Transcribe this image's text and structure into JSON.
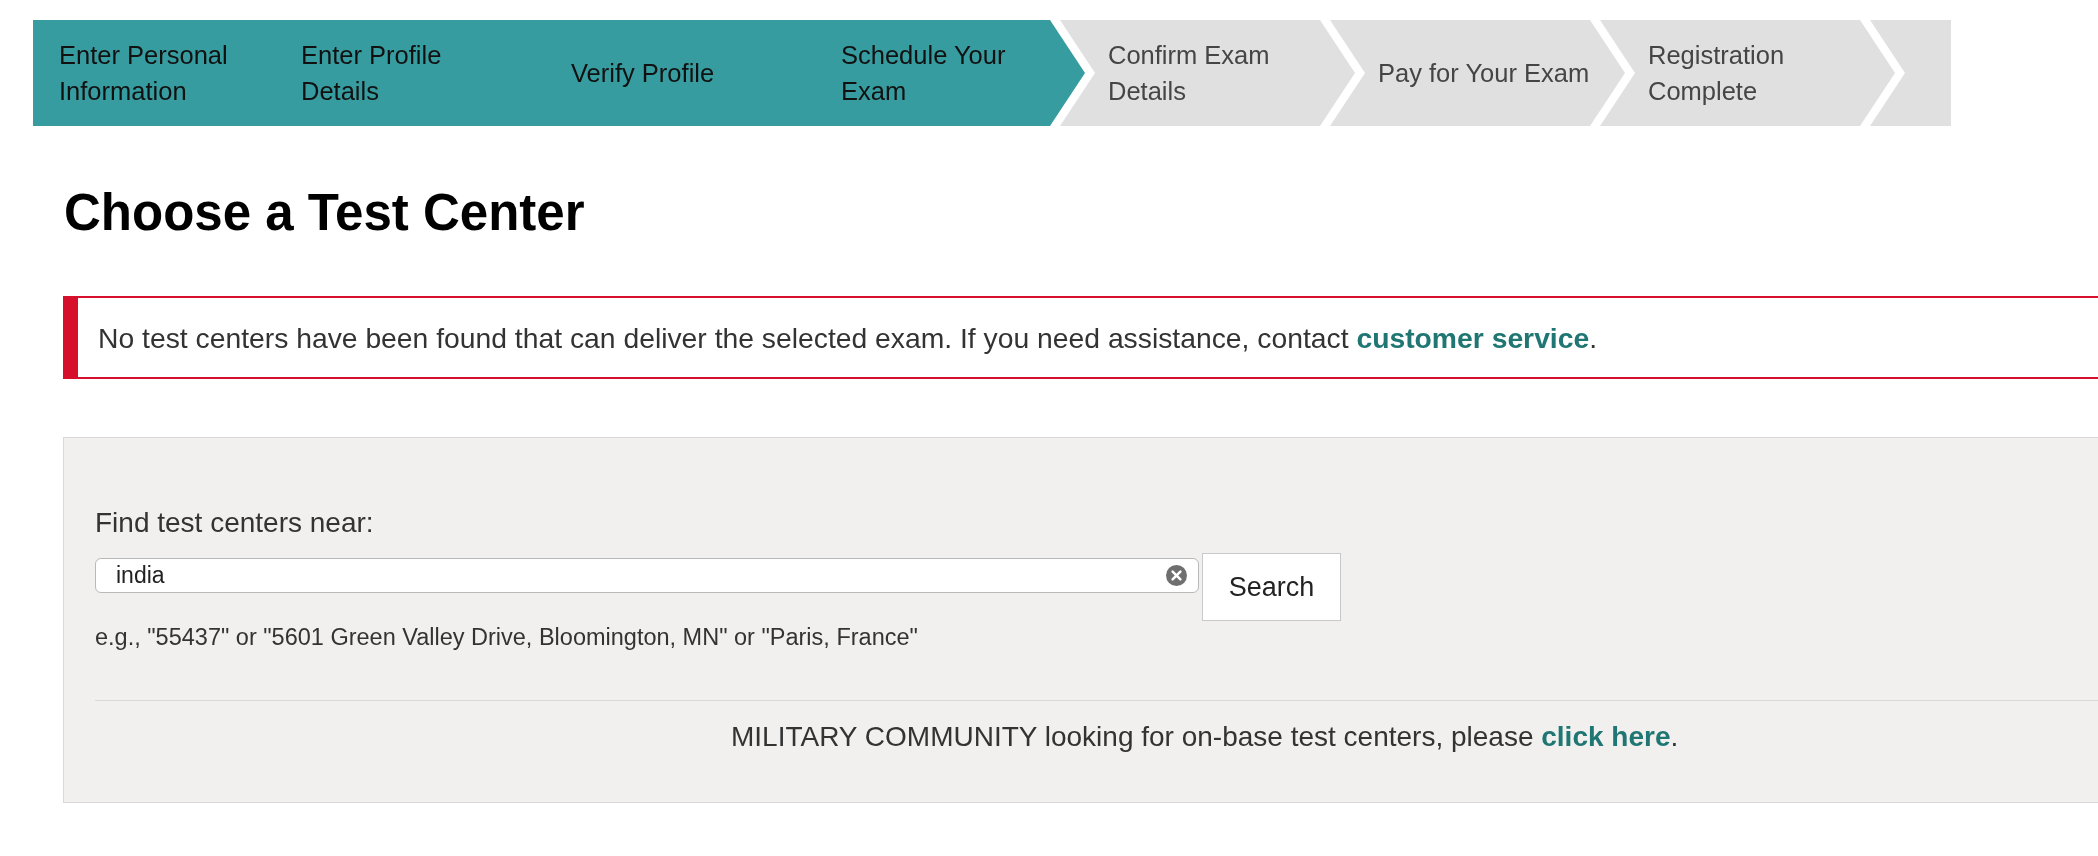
{
  "progress_steps": [
    {
      "label": "Enter Personal Information",
      "completed": true
    },
    {
      "label": "Enter Profile Details",
      "completed": true
    },
    {
      "label": "Verify Profile",
      "completed": true
    },
    {
      "label": "Schedule Your Exam",
      "completed": true
    },
    {
      "label": "Confirm Exam Details",
      "completed": false
    },
    {
      "label": "Pay for Your Exam",
      "completed": false
    },
    {
      "label": "Registration Complete",
      "completed": false
    }
  ],
  "heading": "Choose a Test Center",
  "alert": {
    "text_before": "No test centers have been found that can deliver the selected exam. If you need assistance, contact",
    "link": "customer service",
    "text_after": "."
  },
  "search": {
    "label": "Find test centers near:",
    "value": "india",
    "button": "Search",
    "hint": "e.g., \"55437\" or \"5601 Green Valley Drive, Bloomington, MN\" or \"Paris, France\""
  },
  "military_note": {
    "text_before": "MILITARY COMMUNITY looking for on-base test centers, please",
    "link": "click here",
    "text_after": "."
  }
}
